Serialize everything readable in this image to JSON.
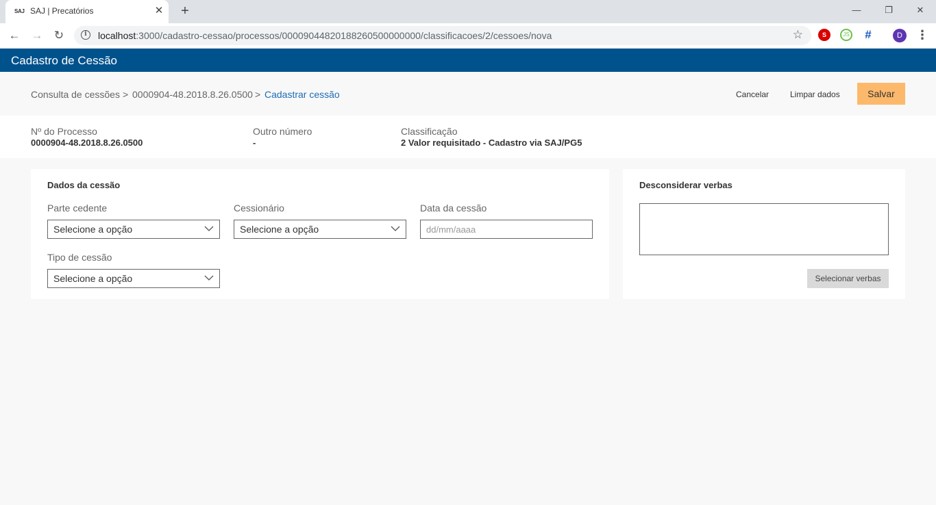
{
  "browser": {
    "tab_favicon": "SAJ",
    "tab_title": "SAJ | Precatórios",
    "close_glyph": "✕",
    "new_tab_glyph": "+",
    "url_host": "localhost",
    "url_rest": ":3000/cadastro-cessao/processos/00009044820188260500000000/classificacoes/2/cessoes/nova",
    "back_glyph": "←",
    "forward_glyph": "→",
    "reload_glyph": "↻",
    "star_glyph": "☆",
    "info_glyph": "i",
    "minimize_glyph": "—",
    "restore_glyph": "❐",
    "window_close_glyph": "✕",
    "menu_glyph": "⋮",
    "profile_initial": "D",
    "ext_stop_label": "S",
    "ext_node_label": "JS",
    "ext_grid_label": "#"
  },
  "app": {
    "title": "Cadastro de Cessão",
    "accent_color": "#00528d",
    "save_color": "#fdb96b"
  },
  "breadcrumb": {
    "items": [
      "Consulta de cessões",
      "0000904-48.2018.8.26.0500",
      "Cadastrar cessão"
    ],
    "separator": ">"
  },
  "actions": {
    "cancel": "Cancelar",
    "clear": "Limpar dados",
    "save": "Salvar"
  },
  "process_info": {
    "process_number_label": "Nº do Processo",
    "process_number_value": "0000904-48.2018.8.26.0500",
    "other_number_label": "Outro número",
    "other_number_value": "-",
    "classification_label": "Classificação",
    "classification_value": "2 Valor requisitado - Cadastro via SAJ/PG5"
  },
  "dados_cessao": {
    "title": "Dados da cessão",
    "parte_cedente_label": "Parte cedente",
    "parte_cedente_value": "Selecione a opção",
    "cessionario_label": "Cessionário",
    "cessionario_value": "Selecione a opção",
    "data_label": "Data da cessão",
    "data_placeholder": "dd/mm/aaaa",
    "tipo_label": "Tipo de cessão",
    "tipo_value": "Selecione a opção"
  },
  "desconsiderar": {
    "title": "Desconsiderar verbas",
    "button": "Selecionar verbas"
  }
}
